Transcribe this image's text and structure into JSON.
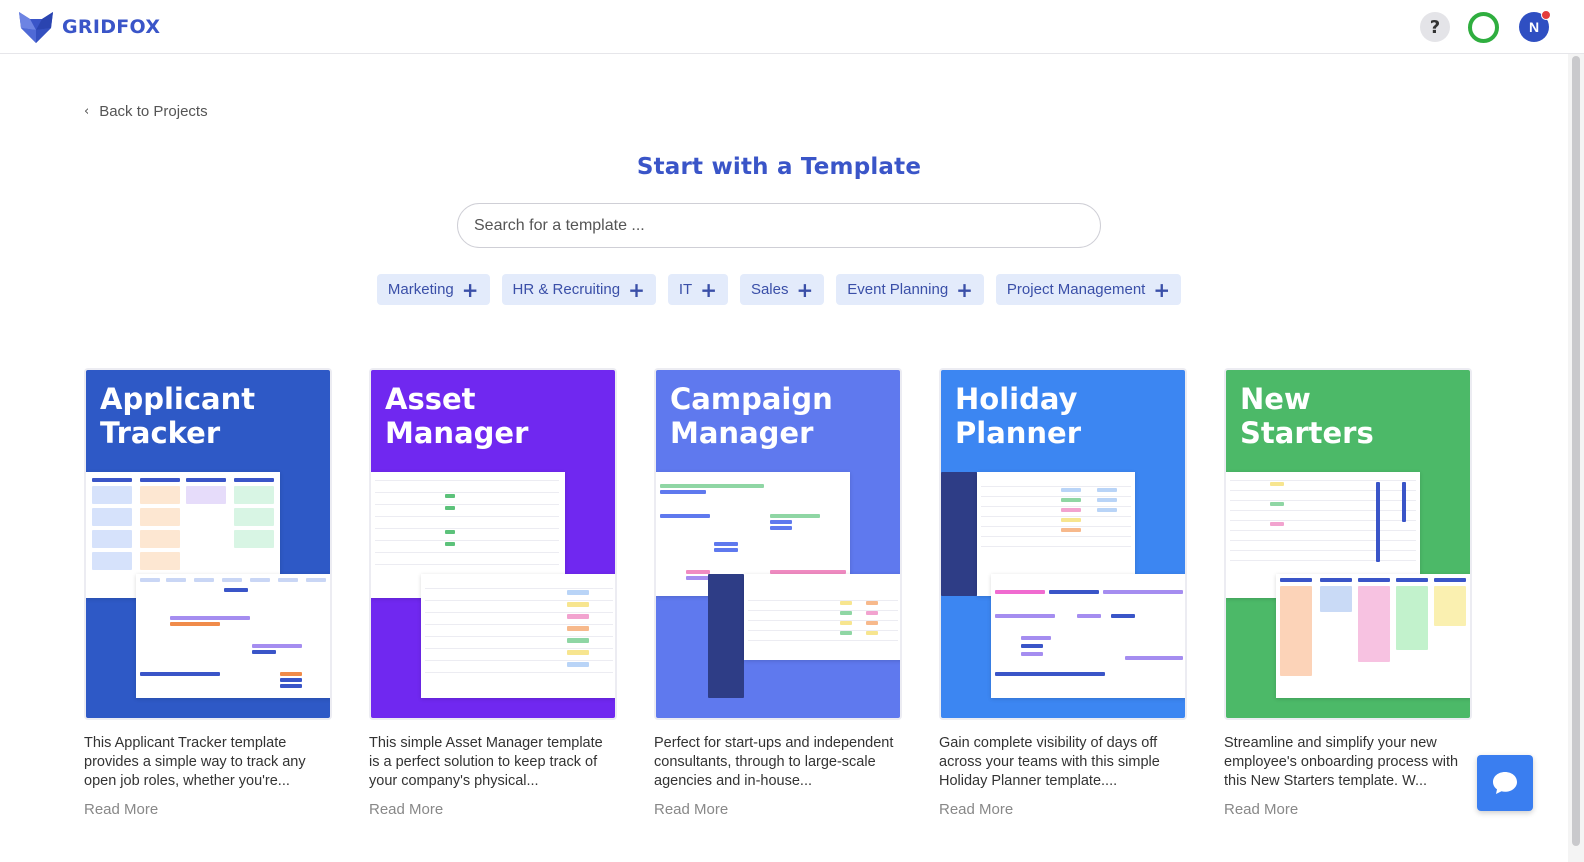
{
  "brand": {
    "name": "GRIDFOX",
    "color": "#3a55c8"
  },
  "header": {
    "help_label": "?",
    "avatar_initial": "N"
  },
  "back_link": {
    "label": "Back to Projects"
  },
  "page": {
    "title": "Start with a Template"
  },
  "search": {
    "placeholder": "Search for a template ..."
  },
  "filters": [
    "Marketing",
    "HR & Recruiting",
    "IT",
    "Sales",
    "Event Planning",
    "Project Management"
  ],
  "templates": [
    {
      "title_line1": "Applicant",
      "title_line2": "Tracker",
      "color": "#2e59c6",
      "description": "This Applicant Tracker template provides a simple way to track any open job roles, whether you're...",
      "read_more": "Read More"
    },
    {
      "title_line1": "Asset",
      "title_line2": "Manager",
      "color": "#7028f0",
      "description": "This simple Asset Manager template is a perfect solution to keep track of your company's physical...",
      "read_more": "Read More"
    },
    {
      "title_line1": "Campaign",
      "title_line2": "Manager",
      "color": "#5f79ee",
      "description": "Perfect for start-ups and independent consultants, through to large-scale agencies and in-house...",
      "read_more": "Read More"
    },
    {
      "title_line1": "Holiday",
      "title_line2": "Planner",
      "color": "#3c86f2",
      "description": "Gain complete visibility of days off across your teams with this simple Holiday Planner template....",
      "read_more": "Read More"
    },
    {
      "title_line1": "New",
      "title_line2": "Starters",
      "color": "#4cb968",
      "description": "Streamline and simplify your new employee's onboarding process with this New Starters template. W...",
      "read_more": "Read More"
    }
  ],
  "icons": {
    "logo": "gridfox-fox-logo",
    "help": "question-mark-icon",
    "status": "status-ring-icon",
    "back": "chevron-left-icon",
    "chat": "chat-bubble-icon",
    "filter_add": "plus-icon"
  }
}
